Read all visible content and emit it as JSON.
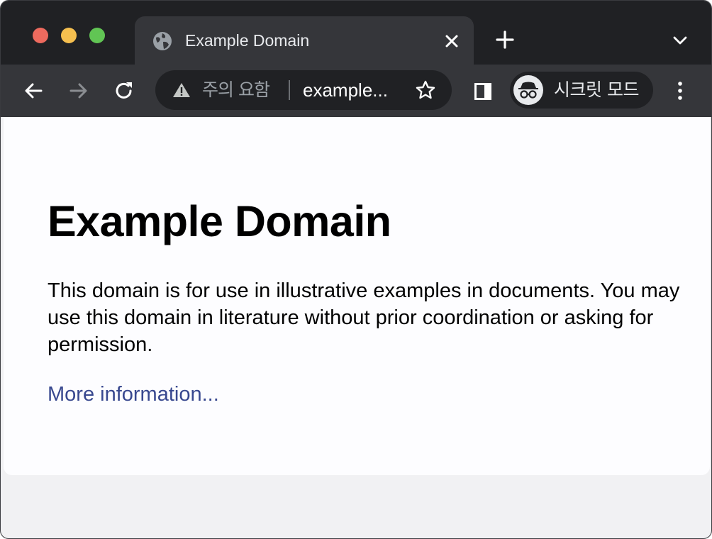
{
  "browser": {
    "tab": {
      "title": "Example Domain",
      "favicon": "globe-icon"
    },
    "toolbar": {
      "security_warning": "주의 요함",
      "url_display": "example...",
      "profile_label": "시크릿 모드",
      "profile_icon": "incognito-icon"
    },
    "colors": {
      "chrome_dark": "#202124",
      "chrome_mid": "#35363a",
      "traffic_red": "#ed6a5e",
      "traffic_yellow": "#f5bf4f",
      "traffic_green": "#61c554"
    }
  },
  "page": {
    "heading": "Example Domain",
    "paragraph": "This domain is for use in illustrative examples in documents. You may use this domain in literature without prior coordination or asking for permission.",
    "link_text": "More information...",
    "link_color": "#38488f"
  }
}
